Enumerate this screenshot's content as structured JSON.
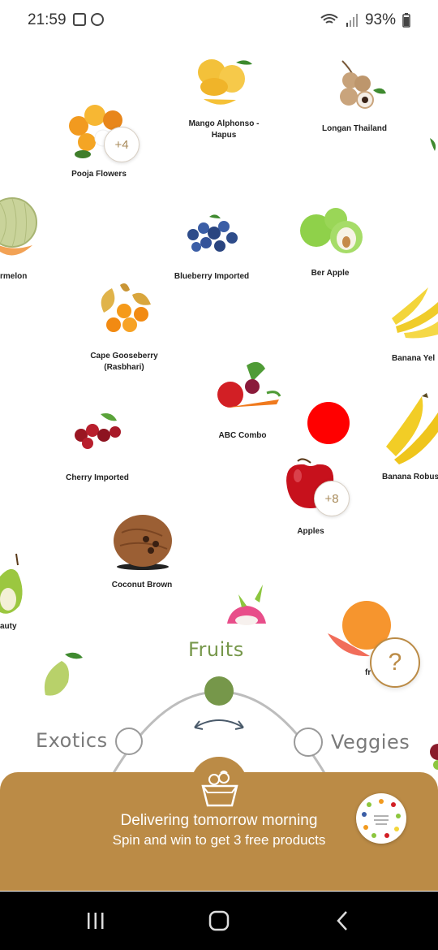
{
  "status_bar": {
    "time": "21:59",
    "battery": "93%"
  },
  "products": [
    {
      "id": "pooja-flowers",
      "name": "Pooja Flowers",
      "badge": "+4"
    },
    {
      "id": "mango",
      "name_line1": "Mango Alphonso -",
      "name_line2": "Hapus"
    },
    {
      "id": "longan",
      "name": "Longan Thailand"
    },
    {
      "id": "watermelon",
      "name": "rmelon"
    },
    {
      "id": "blueberry",
      "name": "Blueberry Imported"
    },
    {
      "id": "ber-apple",
      "name": "Ber Apple"
    },
    {
      "id": "cape-gooseberry",
      "name_line1": "Cape Gooseberry",
      "name_line2": "(Rasbhari)"
    },
    {
      "id": "banana-yellow",
      "name": "Banana Yel"
    },
    {
      "id": "abc-combo",
      "name": "ABC Combo"
    },
    {
      "id": "cherry",
      "name": "Cherry Imported"
    },
    {
      "id": "banana-robusta",
      "name": "Banana Robus"
    },
    {
      "id": "apples",
      "name": "Apples",
      "badge": "+8"
    },
    {
      "id": "coconut",
      "name": "Coconut Brown"
    },
    {
      "id": "pear",
      "name": "auty"
    },
    {
      "id": "grapefruit",
      "name": "fr"
    }
  ],
  "dial": {
    "active": "Fruits",
    "left": "Exotics",
    "right": "Veggies",
    "active_color": "#76974a"
  },
  "help": {
    "label": "?"
  },
  "delivery_panel": {
    "title": "Delivering tomorrow morning",
    "subtitle": "Spin and win to get 3 free products",
    "color": "#bb8b46"
  },
  "icons": {
    "box": "fruit-box-icon",
    "recents": "recents-icon",
    "home": "home-icon",
    "back": "back-icon"
  }
}
